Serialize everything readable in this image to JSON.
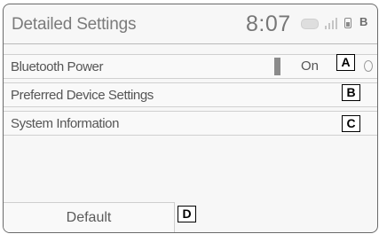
{
  "header": {
    "title": "Detailed Settings",
    "clock": "8:07",
    "icons": [
      "media-badge-icon",
      "signal-bars-icon",
      "phone-battery-icon",
      "bluetooth-icon"
    ],
    "bt_icon_text": "B"
  },
  "settings": {
    "items": [
      {
        "label": "Bluetooth Power",
        "value": "On",
        "callout": "A"
      },
      {
        "label": "Preferred Device Settings",
        "callout": "B"
      },
      {
        "label": "System Information",
        "callout": "C"
      }
    ]
  },
  "footer": {
    "default_label": "Default",
    "callout": "D"
  }
}
